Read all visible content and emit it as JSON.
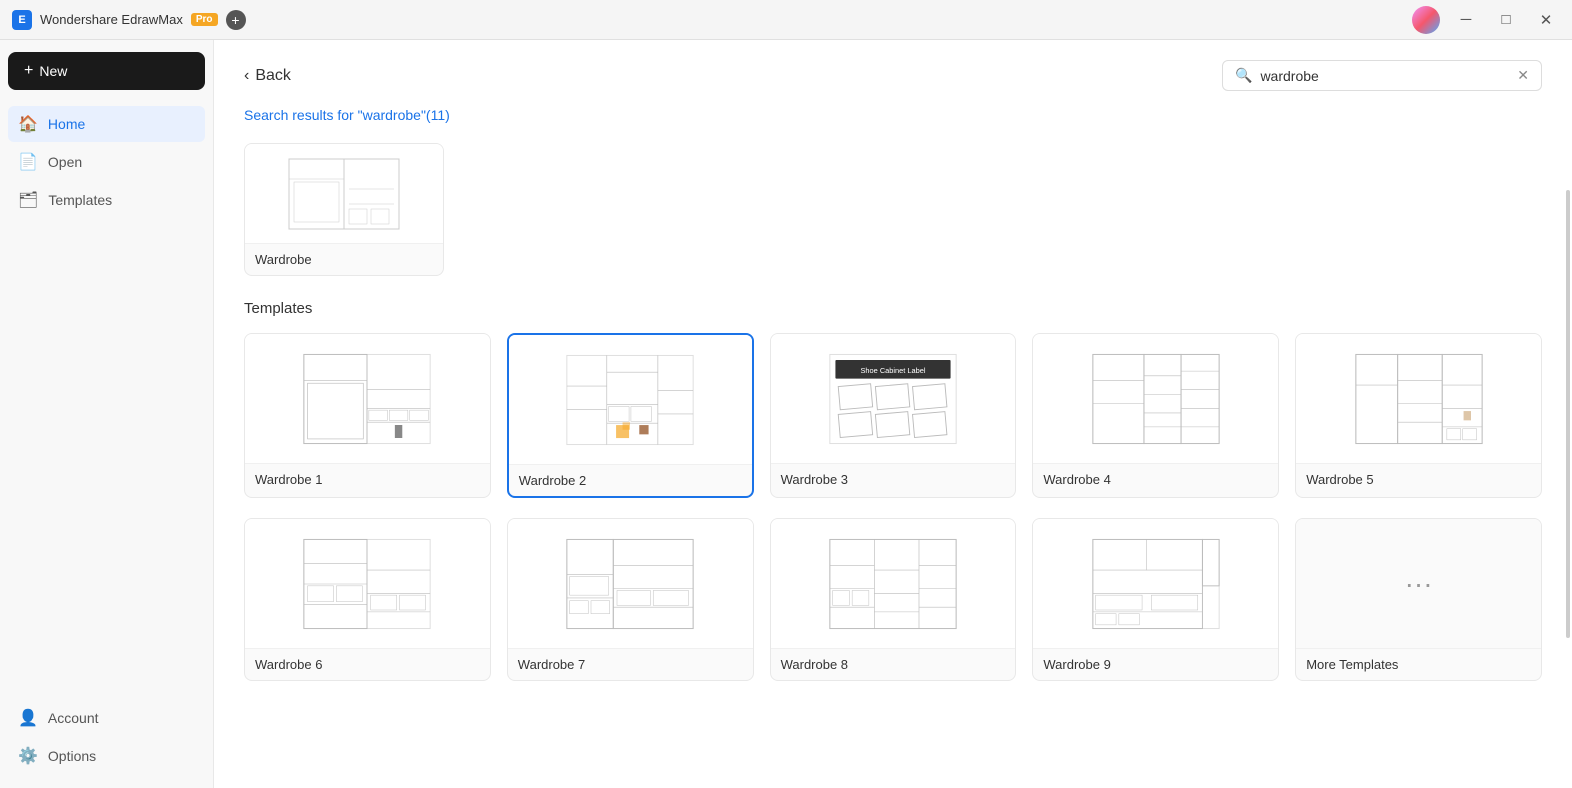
{
  "titlebar": {
    "logo_text": "E",
    "app_name": "Wondershare EdrawMax",
    "pro_label": "Pro",
    "new_tab_label": "+"
  },
  "sidebar": {
    "new_button_label": "New",
    "items": [
      {
        "id": "home",
        "label": "Home",
        "icon": "🏠",
        "active": true
      },
      {
        "id": "open",
        "label": "Open",
        "icon": "📄",
        "active": false
      },
      {
        "id": "templates",
        "label": "Templates",
        "icon": "🗂",
        "active": false
      }
    ],
    "bottom_items": [
      {
        "id": "account",
        "label": "Account",
        "icon": "👤"
      },
      {
        "id": "options",
        "label": "Options",
        "icon": "⚙️"
      }
    ]
  },
  "header": {
    "back_label": "Back",
    "search_placeholder": "wardrobe",
    "search_value": "wardrobe"
  },
  "content": {
    "search_results_prefix": "Search results for ",
    "search_keyword": "\"wardrobe\"",
    "search_count": "(11)",
    "top_result_label": "Wardrobe",
    "templates_section_label": "Templates",
    "templates": [
      {
        "id": 1,
        "label": "Wardrobe 1",
        "selected": false
      },
      {
        "id": 2,
        "label": "Wardrobe 2",
        "selected": true
      },
      {
        "id": 3,
        "label": "Wardrobe 3",
        "selected": false
      },
      {
        "id": 4,
        "label": "Wardrobe 4",
        "selected": false
      },
      {
        "id": 5,
        "label": "Wardrobe 5",
        "selected": false
      },
      {
        "id": 6,
        "label": "Wardrobe 6",
        "selected": false
      },
      {
        "id": 7,
        "label": "Wardrobe 7",
        "selected": false
      },
      {
        "id": 8,
        "label": "Wardrobe 8",
        "selected": false
      },
      {
        "id": 9,
        "label": "Wardrobe 9",
        "selected": false
      },
      {
        "id": 10,
        "label": "More Templates",
        "selected": false,
        "is_more": true
      }
    ]
  },
  "icons": {
    "bell": "🔔",
    "help": "?",
    "users": "👥",
    "share": "🔗",
    "settings": "⚙"
  },
  "colors": {
    "accent": "#1a73e8",
    "pro_badge": "#f5a623"
  }
}
